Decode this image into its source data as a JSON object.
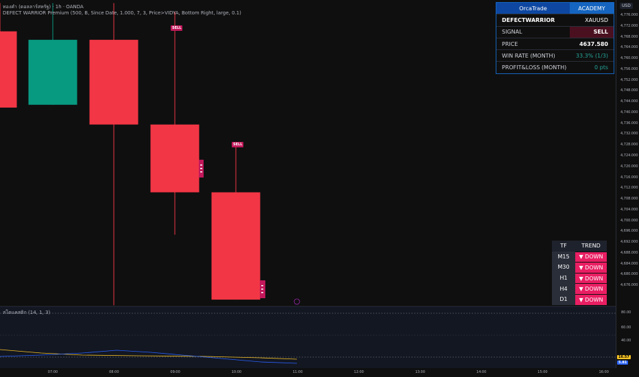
{
  "header": {
    "symbol_line": "ทองคำ (ดอลลาร์สหรัฐ) · 1h · OANDA",
    "indicator_line": "DEFECT WARRIOR Premium  (500, B, Since Date, 1.000, 7, 3, Price>VIDYA, Bottom Right, large, 0.1)",
    "sub_indicator": "สโตแคสติก (14, 1, 3)"
  },
  "price_axis": {
    "currency": "USD",
    "ticks": [
      "4,776.000",
      "4,772.000",
      "4,768.000",
      "4,764.000",
      "4,760.000",
      "4,756.000",
      "4,752.000",
      "4,748.000",
      "4,744.000",
      "4,740.000",
      "4,736.000",
      "4,732.000",
      "4,728.000",
      "4,724.000",
      "4,720.000",
      "4,716.000",
      "4,712.000",
      "4,708.000",
      "4,704.000",
      "4,700.000",
      "4,696.000",
      "4,692.000",
      "4,688.000",
      "4,684.000",
      "4,680.000",
      "4,676.000"
    ]
  },
  "time_axis": [
    "07:00",
    "08:00",
    "09:00",
    "10:00",
    "11:00",
    "12:00",
    "13:00",
    "14:00",
    "15:00",
    "16:00"
  ],
  "indicator_axis": {
    "ticks": [
      "80.00",
      "60.00",
      "40.00"
    ],
    "badge_k": "16.57",
    "badge_d": "5.81"
  },
  "signals": [
    "SELL",
    "SELL"
  ],
  "info_table": {
    "brand": "OrcaTrade",
    "brand_tag": "ACADEMY",
    "rows": [
      {
        "label": "DEFECTWARRIOR",
        "value": "XAUUSD"
      },
      {
        "label": "SIGNAL",
        "value": "SELL"
      },
      {
        "label": "PRICE",
        "value": "4637.580"
      },
      {
        "label": "WIN RATE (MONTH)",
        "value": "33.3% (1/3)"
      },
      {
        "label": "PROFIT&LOSS (MONTH)",
        "value": "0 pts"
      }
    ]
  },
  "trend_table": {
    "headers": {
      "tf": "TF",
      "trend": "TREND"
    },
    "rows": [
      {
        "tf": "M15",
        "trend": "▼ DOWN"
      },
      {
        "tf": "M30",
        "trend": "▼ DOWN"
      },
      {
        "tf": "H1",
        "trend": "▼ DOWN"
      },
      {
        "tf": "H4",
        "trend": "▼ DOWN"
      },
      {
        "tf": "D1",
        "trend": "▼ DOWN"
      }
    ]
  },
  "colors": {
    "bull": "#089981",
    "bear": "#f23645",
    "signal": "#c2185b",
    "trend_down": "#e91e63",
    "brand": "#0d47a1",
    "win_rate": "#26a69a"
  },
  "candles": [
    {
      "time": "06:00",
      "open": 4770,
      "high": 4780,
      "close": 4743
    },
    {
      "time": "07:00",
      "open": 4744,
      "high": 4780,
      "close": 4767
    },
    {
      "time": "08:00",
      "open": 4767,
      "high": 4780,
      "low": 4673,
      "close": 4737
    },
    {
      "time": "09:00",
      "open": 4737,
      "high": 4777,
      "low": 4698,
      "close": 4713
    },
    {
      "time": "10:00",
      "open": 4713,
      "high": 4730,
      "close": 4675
    }
  ]
}
